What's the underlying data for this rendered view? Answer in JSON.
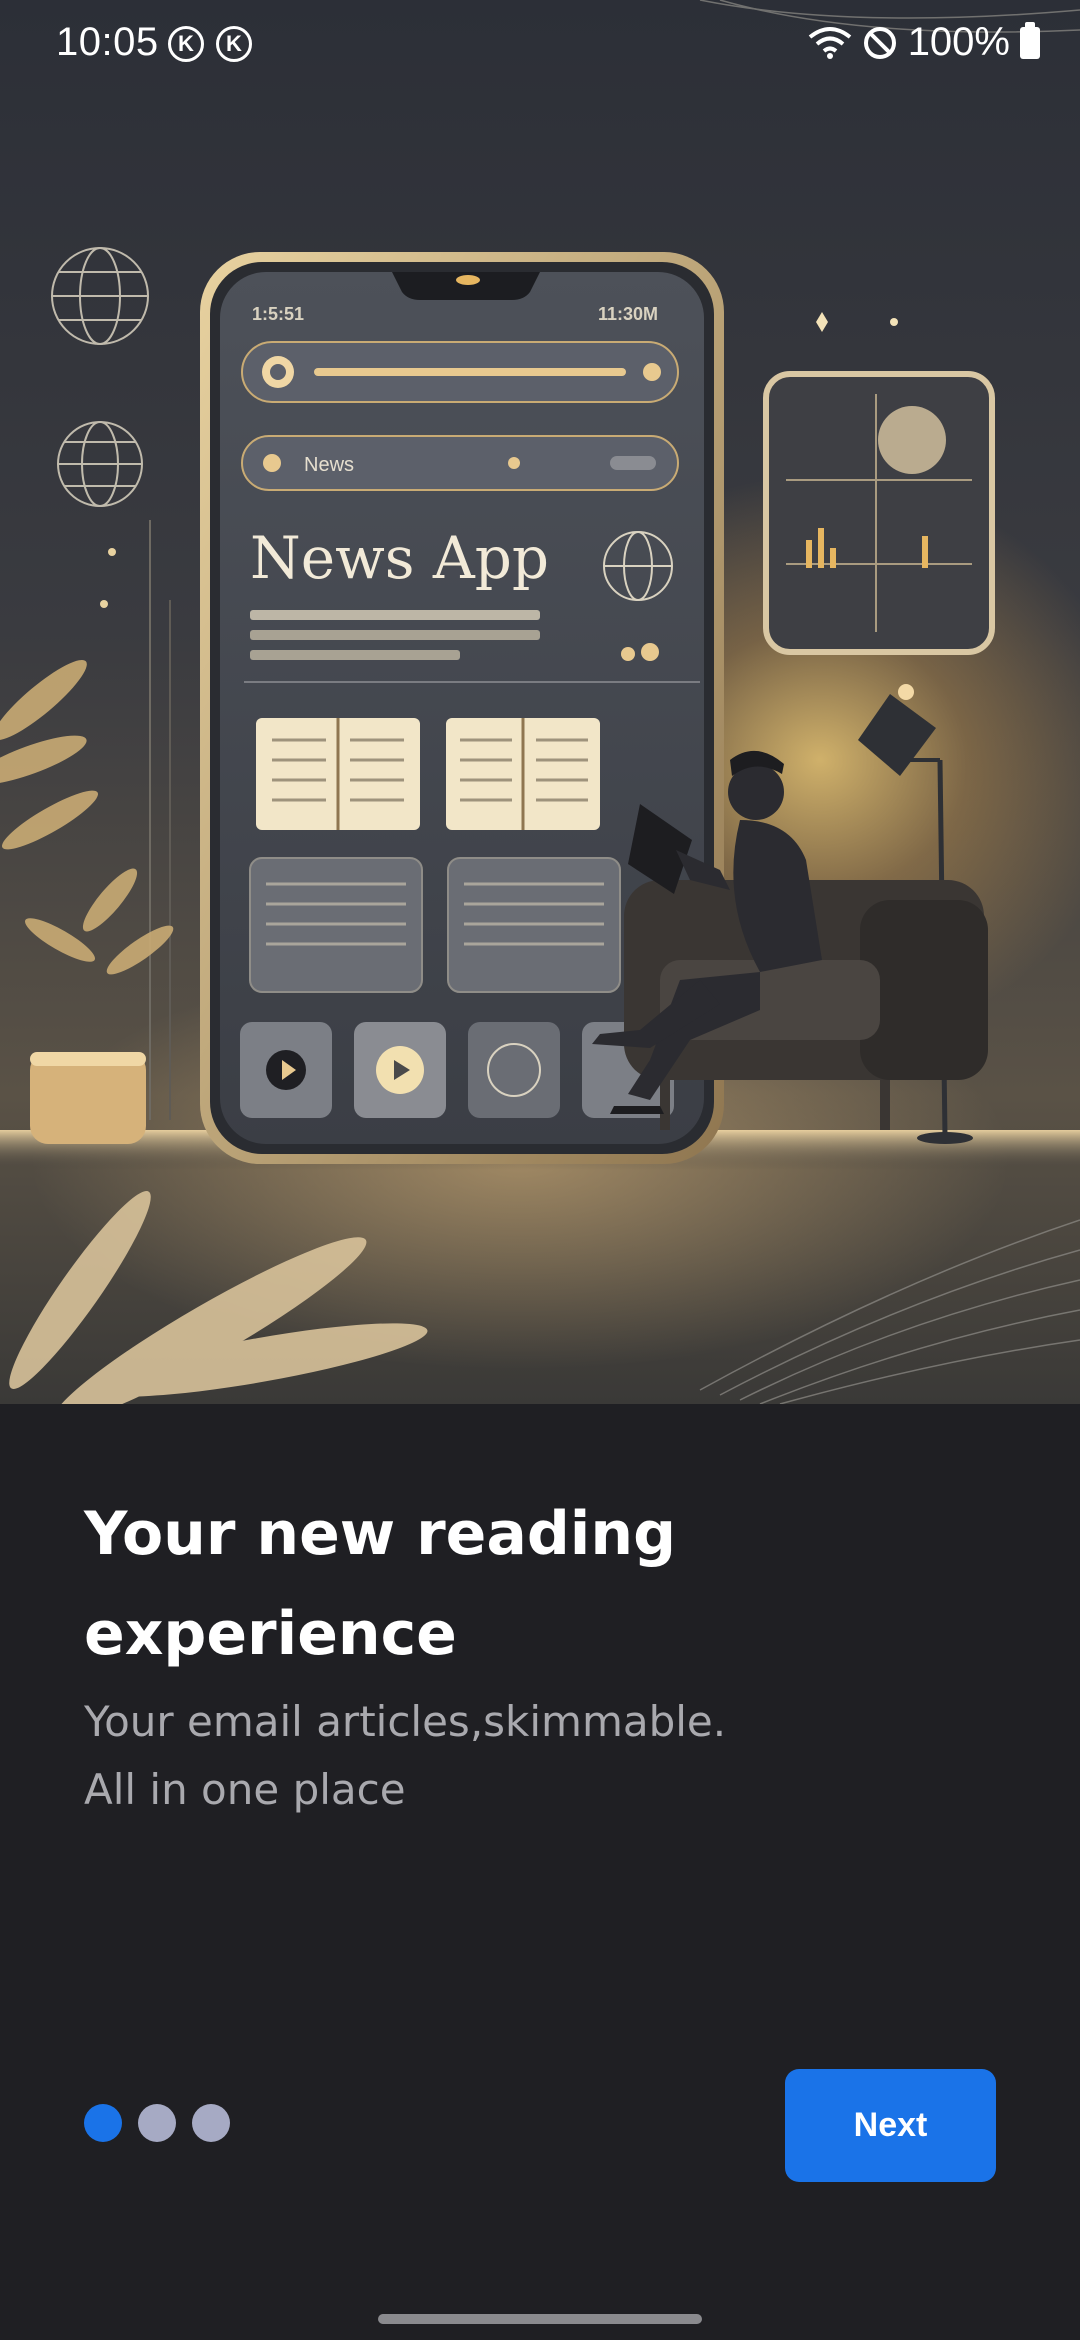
{
  "status_bar": {
    "time": "10:05",
    "notification_badges": [
      "K",
      "K"
    ],
    "battery": "100%",
    "icons": [
      "wifi-icon",
      "do-not-disturb-icon",
      "battery-icon"
    ]
  },
  "hero": {
    "illustration": "news-app-reading-illustration",
    "phone_mockup": {
      "app_name": "News App",
      "time_left": "1:5:51",
      "time_right": "11:30M",
      "search_label": "News"
    }
  },
  "onboarding": {
    "title": "Your new reading experience",
    "subtitle_line1": "Your email articles,skimmable.",
    "subtitle_line2": "All in one place",
    "page_count": 3,
    "active_page": 1,
    "next_label": "Next"
  },
  "colors": {
    "background": "#1f1f23",
    "accent": "#1a73e8",
    "dot_inactive": "#a6aac4",
    "subtitle": "#a9a9ae"
  }
}
